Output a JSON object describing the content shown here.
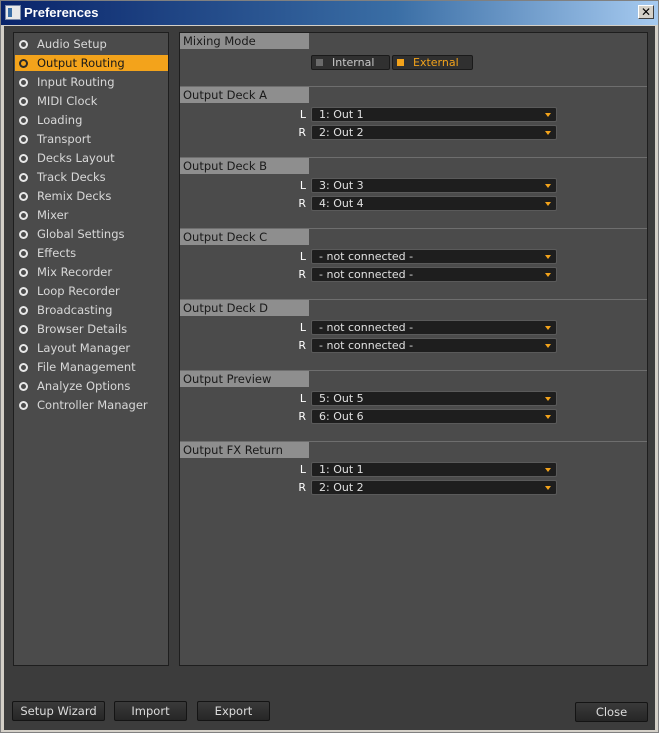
{
  "window": {
    "title": "Preferences",
    "close_glyph": "✕"
  },
  "sidebar": {
    "items": [
      {
        "label": "Audio Setup",
        "active": false
      },
      {
        "label": "Output Routing",
        "active": true
      },
      {
        "label": "Input Routing",
        "active": false
      },
      {
        "label": "MIDI Clock",
        "active": false
      },
      {
        "label": "Loading",
        "active": false
      },
      {
        "label": "Transport",
        "active": false
      },
      {
        "label": "Decks Layout",
        "active": false
      },
      {
        "label": "Track Decks",
        "active": false
      },
      {
        "label": "Remix Decks",
        "active": false
      },
      {
        "label": "Mixer",
        "active": false
      },
      {
        "label": "Global Settings",
        "active": false
      },
      {
        "label": "Effects",
        "active": false
      },
      {
        "label": "Mix Recorder",
        "active": false
      },
      {
        "label": "Loop Recorder",
        "active": false
      },
      {
        "label": "Broadcasting",
        "active": false
      },
      {
        "label": "Browser Details",
        "active": false
      },
      {
        "label": "Layout Manager",
        "active": false
      },
      {
        "label": "File Management",
        "active": false
      },
      {
        "label": "Analyze Options",
        "active": false
      },
      {
        "label": "Controller Manager",
        "active": false
      }
    ]
  },
  "mixing_mode": {
    "title": "Mixing Mode",
    "options": [
      {
        "label": "Internal",
        "selected": false
      },
      {
        "label": "External",
        "selected": true
      }
    ]
  },
  "outputs": [
    {
      "title": "Output Deck A",
      "left_label": "L",
      "left_value": "1: Out 1",
      "right_label": "R",
      "right_value": "2: Out 2"
    },
    {
      "title": "Output Deck B",
      "left_label": "L",
      "left_value": "3: Out 3",
      "right_label": "R",
      "right_value": "4: Out 4"
    },
    {
      "title": "Output Deck C",
      "left_label": "L",
      "left_value": "- not connected -",
      "right_label": "R",
      "right_value": "- not connected -"
    },
    {
      "title": "Output Deck D",
      "left_label": "L",
      "left_value": "- not connected -",
      "right_label": "R",
      "right_value": "- not connected -"
    },
    {
      "title": "Output Preview",
      "left_label": "L",
      "left_value": "5: Out 5",
      "right_label": "R",
      "right_value": "6: Out 6"
    },
    {
      "title": "Output FX Return",
      "left_label": "L",
      "left_value": "1: Out 1",
      "right_label": "R",
      "right_value": "2: Out 2"
    }
  ],
  "footer": {
    "setup_wizard": "Setup Wizard",
    "import": "Import",
    "export": "Export",
    "close": "Close"
  },
  "colors": {
    "accent": "#f3a31b",
    "panel": "#4b4b4b",
    "background": "#3c3c3c",
    "section_header": "#8e8e8e"
  },
  "icons": {
    "app": "preferences-app-icon",
    "close": "close-icon",
    "dropdown": "chevron-down-icon",
    "radio": "radio-icon"
  }
}
